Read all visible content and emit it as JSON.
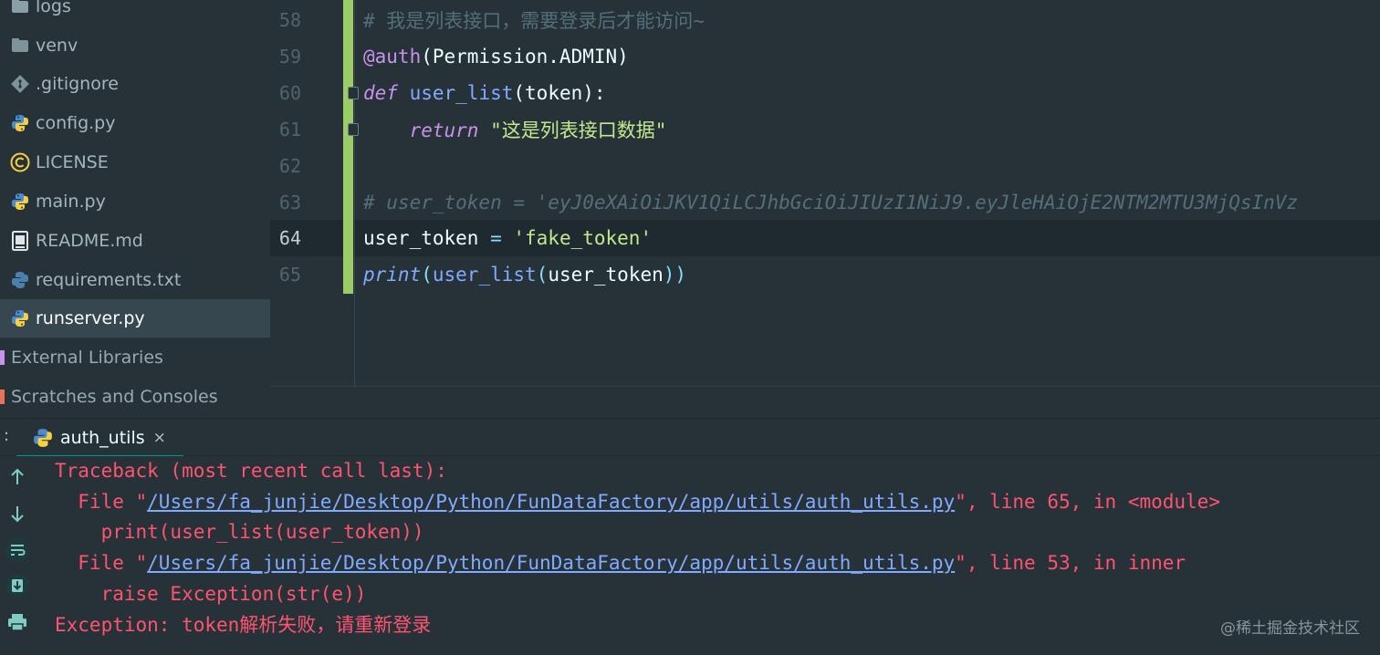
{
  "project_tree": [
    {
      "label": "logs",
      "icon": "folder-icon"
    },
    {
      "label": "venv",
      "icon": "folder-icon"
    },
    {
      "label": ".gitignore",
      "icon": "git-icon"
    },
    {
      "label": "config.py",
      "icon": "python-file-icon"
    },
    {
      "label": "LICENSE",
      "icon": "copyright-icon"
    },
    {
      "label": "main.py",
      "icon": "python-file-icon"
    },
    {
      "label": "README.md",
      "icon": "markdown-file-icon"
    },
    {
      "label": "requirements.txt",
      "icon": "python-requirements-icon"
    },
    {
      "label": "runserver.py",
      "icon": "python-file-icon",
      "selected": true
    },
    {
      "label": "External Libraries",
      "icon": "library-icon"
    },
    {
      "label": "Scratches and Consoles",
      "icon": "scratches-icon"
    }
  ],
  "editor": {
    "current_line": "64",
    "lines": [
      {
        "num": "58",
        "comment": "# 我是列表接口，需要登录后才能访问~"
      },
      {
        "num": "59",
        "decorator": "@auth",
        "args": "(Permission.ADMIN)"
      },
      {
        "num": "60",
        "kw": "def",
        "fn": "user_list",
        "sig": "(token):"
      },
      {
        "num": "61",
        "indent": "    ",
        "kw": "return",
        "str": "\"这是列表接口数据\""
      },
      {
        "num": "62"
      },
      {
        "num": "63",
        "comment": "# user_token = 'eyJ0eXAiOiJKV1QiLCJhbGciOiJIUzI1NiJ9.eyJleHAiOjE2NTM2MTU3MjQsInVz"
      },
      {
        "num": "64",
        "var": "user_token",
        "op": " = ",
        "str": "'fake_token'"
      },
      {
        "num": "65",
        "builtin": "print",
        "p1": "(",
        "fn": "user_list",
        "p2": "(",
        "arg": "user_token",
        "p3": "))"
      }
    ]
  },
  "run_panel": {
    "tab_label": "auth_utils",
    "tab_close": "×",
    "colon": ":",
    "output": {
      "l1": "Traceback (most recent call last):",
      "l2_pre": "  File \"",
      "l2_link": "/Users/fa_junjie/Desktop/Python/FunDataFactory/app/utils/auth_utils.py",
      "l2_post": "\", line 65, in <module>",
      "l3": "    print(user_list(user_token))",
      "l4_pre": "  File \"",
      "l4_link": "/Users/fa_junjie/Desktop/Python/FunDataFactory/app/utils/auth_utils.py",
      "l4_post": "\", line 53, in inner",
      "l5": "    raise Exception(str(e))",
      "l6": "Exception: token解析失败，请重新登录"
    },
    "toolbar": [
      "up-arrow-icon",
      "down-arrow-icon",
      "soft-wrap-icon",
      "scroll-to-end-icon",
      "print-icon"
    ]
  },
  "watermark": "@稀土掘金技术社区",
  "colors": {
    "background": "#263238",
    "selection": "#36474f",
    "change_bar": "#9ccc65",
    "error_text": "#ff5370",
    "link": "#82aaff",
    "tab_accent": "#009688"
  }
}
